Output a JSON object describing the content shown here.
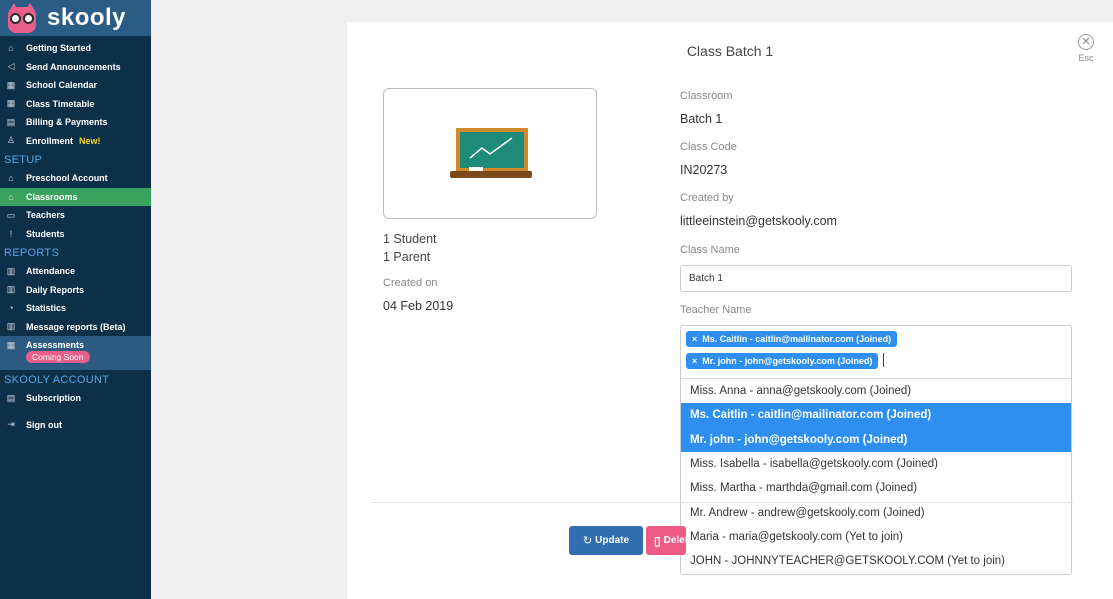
{
  "sidebar": {
    "brand": "skooly",
    "main_items": [
      {
        "icon": "home-icon",
        "glyph": "⌂",
        "label": "Getting Started"
      },
      {
        "icon": "megaphone-icon",
        "glyph": "◁",
        "label": "Send Announcements"
      },
      {
        "icon": "calendar-icon",
        "glyph": "▦",
        "label": "School Calendar"
      },
      {
        "icon": "timetable-icon",
        "glyph": "▦",
        "label": "Class Timetable"
      },
      {
        "icon": "billing-icon",
        "glyph": "▤",
        "label": "Billing & Payments"
      },
      {
        "icon": "enrollment-icon",
        "glyph": "♙",
        "label": "Enrollment",
        "badge": "New!"
      }
    ],
    "setup_title": "SETUP",
    "setup_items": [
      {
        "icon": "school-icon",
        "glyph": "⌂",
        "label": "Preschool Account"
      },
      {
        "icon": "classroom-icon",
        "glyph": "⌂",
        "label": "Classrooms",
        "active": true
      },
      {
        "icon": "teacher-icon",
        "glyph": "▭",
        "label": "Teachers"
      },
      {
        "icon": "student-icon",
        "glyph": "ǃ",
        "label": "Students"
      }
    ],
    "reports_title": "REPORTS",
    "reports_items": [
      {
        "icon": "attendance-icon",
        "glyph": "▥",
        "label": "Attendance"
      },
      {
        "icon": "daily-report-icon",
        "glyph": "▥",
        "label": "Daily Reports"
      },
      {
        "icon": "statistics-icon",
        "glyph": "◔",
        "label": "Statistics"
      },
      {
        "icon": "message-report-icon",
        "glyph": "▥",
        "label": "Message reports (Beta)"
      }
    ],
    "assessments_label": "Assessments",
    "assessments_badge": "Coming Soon",
    "account_title": "SKOOLY ACCOUNT",
    "account_items": [
      {
        "icon": "subscription-icon",
        "glyph": "▤",
        "label": "Subscription"
      },
      {
        "icon": "signout-icon",
        "glyph": "⇥",
        "label": "Sign out"
      }
    ]
  },
  "modal": {
    "title": "Class Batch 1",
    "close_glyph": "✕",
    "esc_label": "Esc",
    "student_count": "1 Student",
    "parent_count": "1 Parent",
    "created_on_label": "Created on",
    "created_on_value": "04 Feb 2019",
    "classroom_label": "Classroom",
    "classroom_value": "Batch 1",
    "class_code_label": "Class Code",
    "class_code_value": "IN20273",
    "created_by_label": "Created by",
    "created_by_value": "littleeinstein@getskooly.com",
    "class_name_label": "Class Name",
    "class_name_value": "Batch 1",
    "teacher_name_label": "Teacher Name",
    "selected_teachers": [
      "Ms. Caitlin - caitlin@mailinator.com (Joined)",
      "Mr. john - john@getskooly.com (Joined)"
    ],
    "tag_remove_glyph": "×",
    "teacher_options": [
      {
        "label": "Miss. Anna - anna@getskooly.com (Joined)",
        "selected": false
      },
      {
        "label": "Ms. Caitlin - caitlin@mailinator.com (Joined)",
        "selected": true
      },
      {
        "label": "Mr. john - john@getskooly.com (Joined)",
        "selected": true
      },
      {
        "label": "Miss. Isabella - isabella@getskooly.com (Joined)",
        "selected": false
      },
      {
        "label": "Miss. Martha - marthda@gmail.com (Joined)",
        "selected": false
      },
      {
        "label": "Mr. Andrew - andrew@getskooly.com (Joined)",
        "selected": false
      },
      {
        "label": "Maria - maria@getskooly.com (Yet to join)",
        "selected": false
      },
      {
        "label": "JOHN - JOHNNYTEACHER@GETSKOOLY.COM (Yet to join)",
        "selected": false
      }
    ],
    "update_label": "Update",
    "update_glyph": "↻",
    "delete_label": "Delete",
    "delete_glyph": "▯"
  },
  "colors": {
    "sidebar_bg": "#0c3048",
    "active_item": "#3aa25e",
    "accent_blue": "#2e8ff0",
    "update_button": "#2f6fb0",
    "delete_button": "#ee5b85"
  }
}
